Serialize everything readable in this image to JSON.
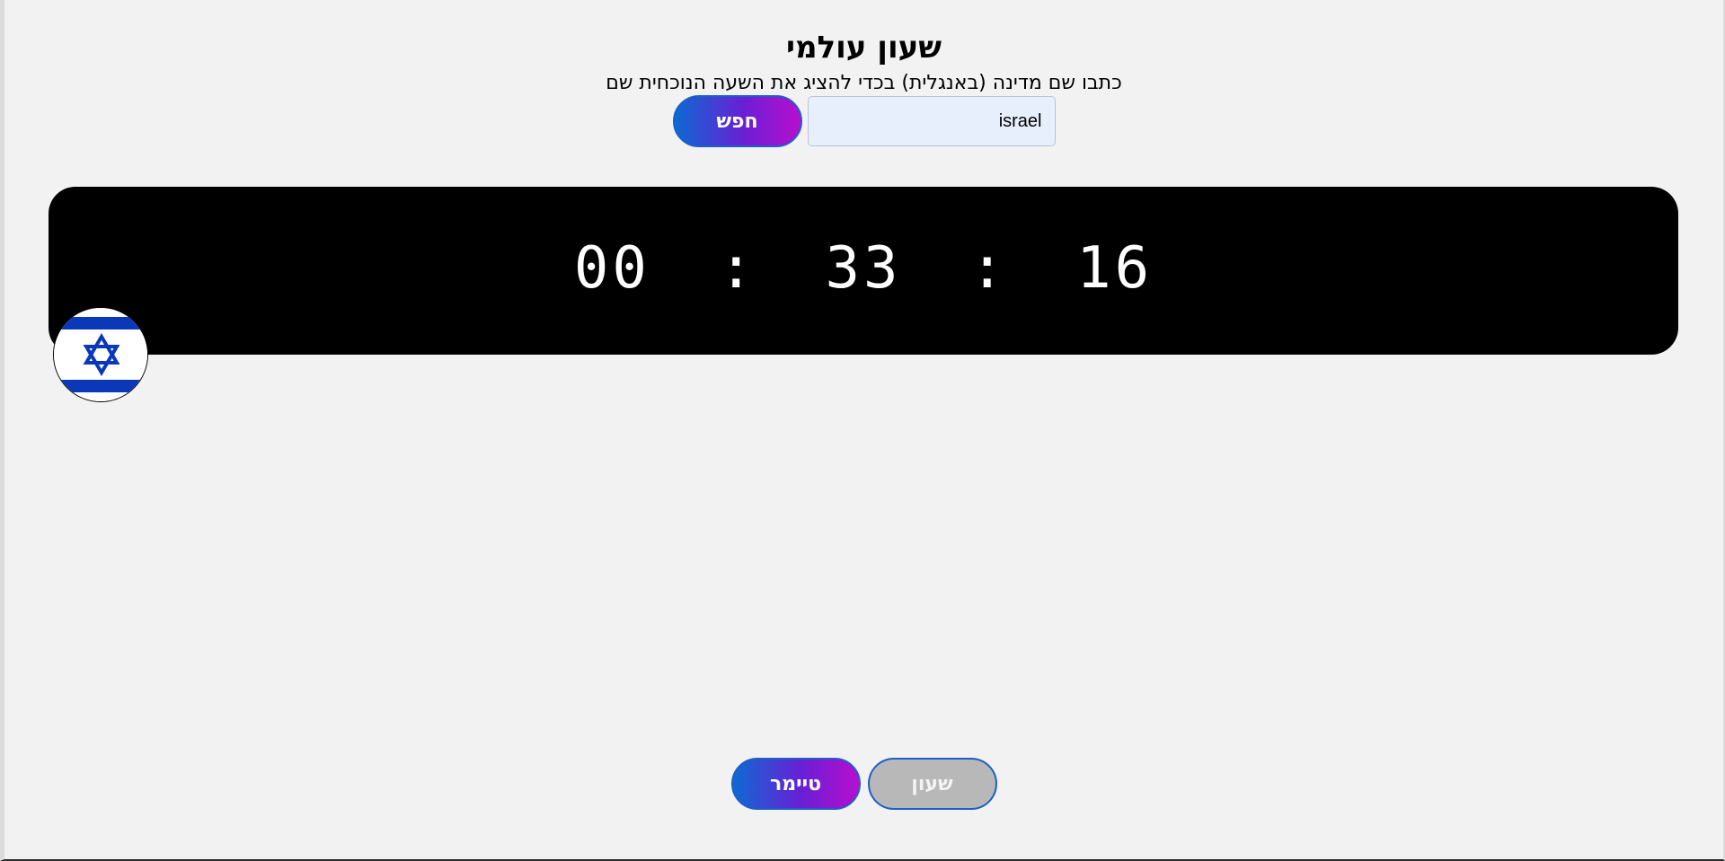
{
  "header": {
    "title": "שעון עולמי",
    "subtitle": "כתבו שם מדינה (באנגלית) בכדי להציג את השעה הנוכחית שם"
  },
  "search": {
    "value": "israel",
    "button_label": "חפש"
  },
  "clock": {
    "hours": "00",
    "separator": ":",
    "minutes": "33",
    "seconds": "16"
  },
  "flag": {
    "country": "israel",
    "icon": "israel-flag-icon",
    "colors": {
      "blue": "#0b38b8",
      "white": "#ffffff"
    }
  },
  "nav": {
    "timer_label": "טיימר",
    "clock_label": "שעון"
  },
  "colors": {
    "gradient_start": "#0d6ad3",
    "gradient_end": "#b80fcf",
    "panel": "#000000",
    "background": "#f2f2f2"
  }
}
